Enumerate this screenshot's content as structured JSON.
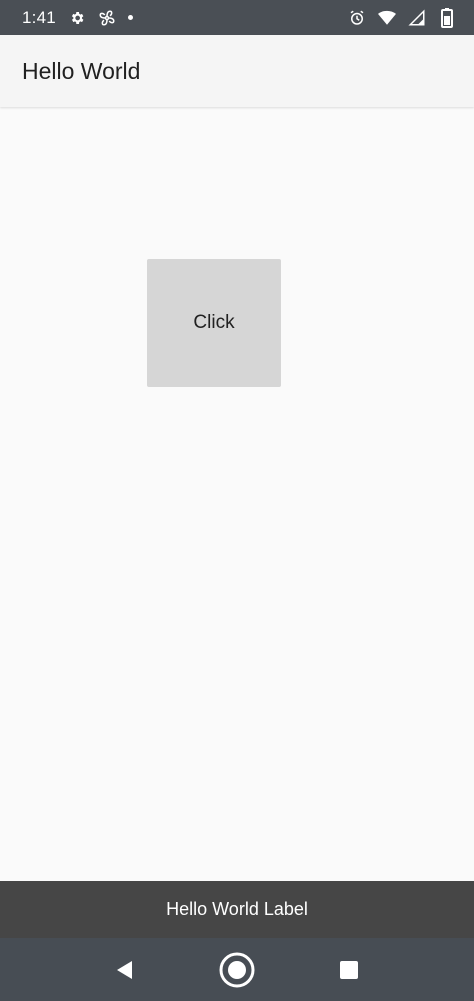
{
  "status_bar": {
    "time": "1:41",
    "left_icons": [
      "settings-gear-icon",
      "fan-icon",
      "notification-dot-icon"
    ],
    "right_icons": [
      "alarm-icon",
      "wifi-icon",
      "cellular-signal-icon",
      "battery-icon"
    ]
  },
  "app_bar": {
    "title": "Hello World"
  },
  "main": {
    "click_button_label": "Click"
  },
  "bottom_label": {
    "text": "Hello World Label"
  },
  "nav_bar": {
    "buttons": [
      "back-icon",
      "home-icon",
      "recents-icon"
    ]
  },
  "colors": {
    "status_bar_bg": "#4a4f55",
    "app_bar_bg": "#f5f5f5",
    "background": "#fafafa",
    "button_bg": "#d6d6d6",
    "label_bar_bg": "#464646",
    "nav_bar_bg": "#474d54"
  }
}
